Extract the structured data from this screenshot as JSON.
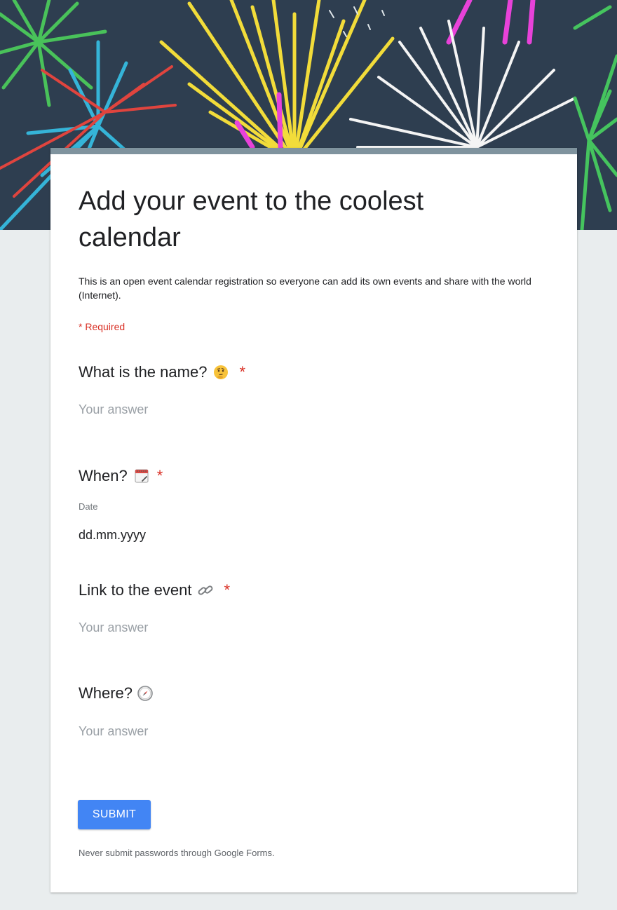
{
  "form": {
    "title": "Add your event to the coolest calendar",
    "description": "This is an open event calendar registration so everyone can add its own events and share with the world (Internet).",
    "required_note": "* Required",
    "questions": [
      {
        "title": "What is the name?",
        "emoji_icon": "thinking-face-icon",
        "required_mark": "*",
        "placeholder": "Your answer"
      },
      {
        "title": "When?",
        "emoji_icon": "calendar-icon",
        "required_mark": "*",
        "sublabel": "Date",
        "value": "dd.mm.yyyy"
      },
      {
        "title": "Link to the event",
        "emoji_icon": "link-icon",
        "required_mark": "*",
        "placeholder": "Your answer"
      },
      {
        "title": "Where?",
        "emoji_icon": "compass-icon",
        "placeholder": "Your answer"
      }
    ],
    "submit_label": "SUBMIT",
    "footer_note": "Never submit passwords through Google Forms."
  },
  "colors": {
    "page_background": "#e9edee",
    "banner_background": "#2e3e50",
    "card_accent": "#7f939e",
    "required": "#d93025",
    "submit_button": "#4285f4"
  }
}
